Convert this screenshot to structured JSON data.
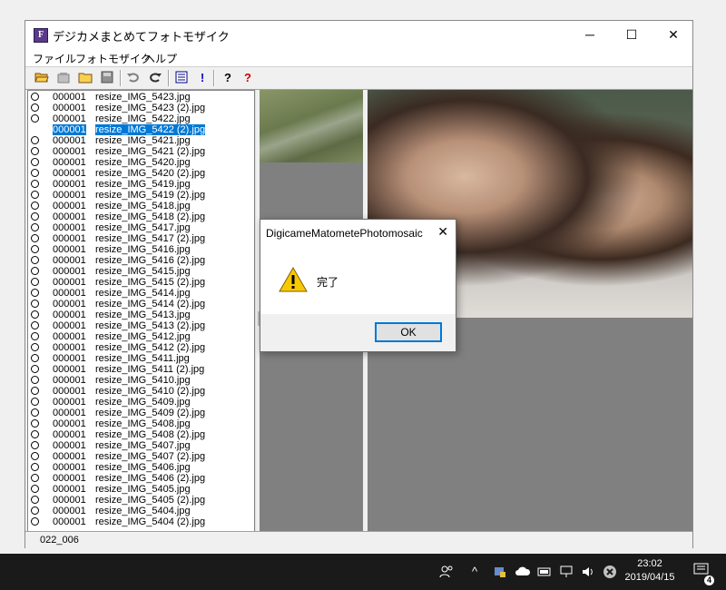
{
  "window": {
    "title": "デジカメまとめてフォトモザイク",
    "controls": {
      "minimize": "─",
      "maximize": "☐",
      "close": "✕"
    }
  },
  "menu": [
    "ファイル",
    "フォトモザイク",
    "ヘルプ"
  ],
  "toolbar": [
    "open-folder-icon",
    "new-icon",
    "folder-icon",
    "save-icon",
    "undo-icon",
    "redo-icon",
    "list-icon",
    "exclaim-icon",
    "help-icon",
    "context-help-icon"
  ],
  "file_list": {
    "selected_index": 3,
    "items": [
      {
        "num": "000001",
        "name": "resize_IMG_5423.jpg"
      },
      {
        "num": "000001",
        "name": "resize_IMG_5423 (2).jpg"
      },
      {
        "num": "000001",
        "name": "resize_IMG_5422.jpg"
      },
      {
        "num": "000001",
        "name": "resize_IMG_5422 (2).jpg"
      },
      {
        "num": "000001",
        "name": "resize_IMG_5421.jpg"
      },
      {
        "num": "000001",
        "name": "resize_IMG_5421 (2).jpg"
      },
      {
        "num": "000001",
        "name": "resize_IMG_5420.jpg"
      },
      {
        "num": "000001",
        "name": "resize_IMG_5420 (2).jpg"
      },
      {
        "num": "000001",
        "name": "resize_IMG_5419.jpg"
      },
      {
        "num": "000001",
        "name": "resize_IMG_5419 (2).jpg"
      },
      {
        "num": "000001",
        "name": "resize_IMG_5418.jpg"
      },
      {
        "num": "000001",
        "name": "resize_IMG_5418 (2).jpg"
      },
      {
        "num": "000001",
        "name": "resize_IMG_5417.jpg"
      },
      {
        "num": "000001",
        "name": "resize_IMG_5417 (2).jpg"
      },
      {
        "num": "000001",
        "name": "resize_IMG_5416.jpg"
      },
      {
        "num": "000001",
        "name": "resize_IMG_5416 (2).jpg"
      },
      {
        "num": "000001",
        "name": "resize_IMG_5415.jpg"
      },
      {
        "num": "000001",
        "name": "resize_IMG_5415 (2).jpg"
      },
      {
        "num": "000001",
        "name": "resize_IMG_5414.jpg"
      },
      {
        "num": "000001",
        "name": "resize_IMG_5414 (2).jpg"
      },
      {
        "num": "000001",
        "name": "resize_IMG_5413.jpg"
      },
      {
        "num": "000001",
        "name": "resize_IMG_5413 (2).jpg"
      },
      {
        "num": "000001",
        "name": "resize_IMG_5412.jpg"
      },
      {
        "num": "000001",
        "name": "resize_IMG_5412 (2).jpg"
      },
      {
        "num": "000001",
        "name": "resize_IMG_5411.jpg"
      },
      {
        "num": "000001",
        "name": "resize_IMG_5411 (2).jpg"
      },
      {
        "num": "000001",
        "name": "resize_IMG_5410.jpg"
      },
      {
        "num": "000001",
        "name": "resize_IMG_5410 (2).jpg"
      },
      {
        "num": "000001",
        "name": "resize_IMG_5409.jpg"
      },
      {
        "num": "000001",
        "name": "resize_IMG_5409 (2).jpg"
      },
      {
        "num": "000001",
        "name": "resize_IMG_5408.jpg"
      },
      {
        "num": "000001",
        "name": "resize_IMG_5408 (2).jpg"
      },
      {
        "num": "000001",
        "name": "resize_IMG_5407.jpg"
      },
      {
        "num": "000001",
        "name": "resize_IMG_5407 (2).jpg"
      },
      {
        "num": "000001",
        "name": "resize_IMG_5406.jpg"
      },
      {
        "num": "000001",
        "name": "resize_IMG_5406 (2).jpg"
      },
      {
        "num": "000001",
        "name": "resize_IMG_5405.jpg"
      },
      {
        "num": "000001",
        "name": "resize_IMG_5405 (2).jpg"
      },
      {
        "num": "000001",
        "name": "resize_IMG_5404.jpg"
      },
      {
        "num": "000001",
        "name": "resize_IMG_5404 (2).jpg"
      }
    ]
  },
  "status": "022_006",
  "dialog": {
    "title": "DigicameMatometePhotomosaic",
    "close": "✕",
    "message": "完了",
    "ok": "OK"
  },
  "taskbar": {
    "time": "23:02",
    "date": "2019/04/15",
    "notification_count": "4"
  },
  "colors": {
    "selection": "#0078d7",
    "taskbar": "#1a1a1a",
    "pane_bg": "#808080"
  }
}
